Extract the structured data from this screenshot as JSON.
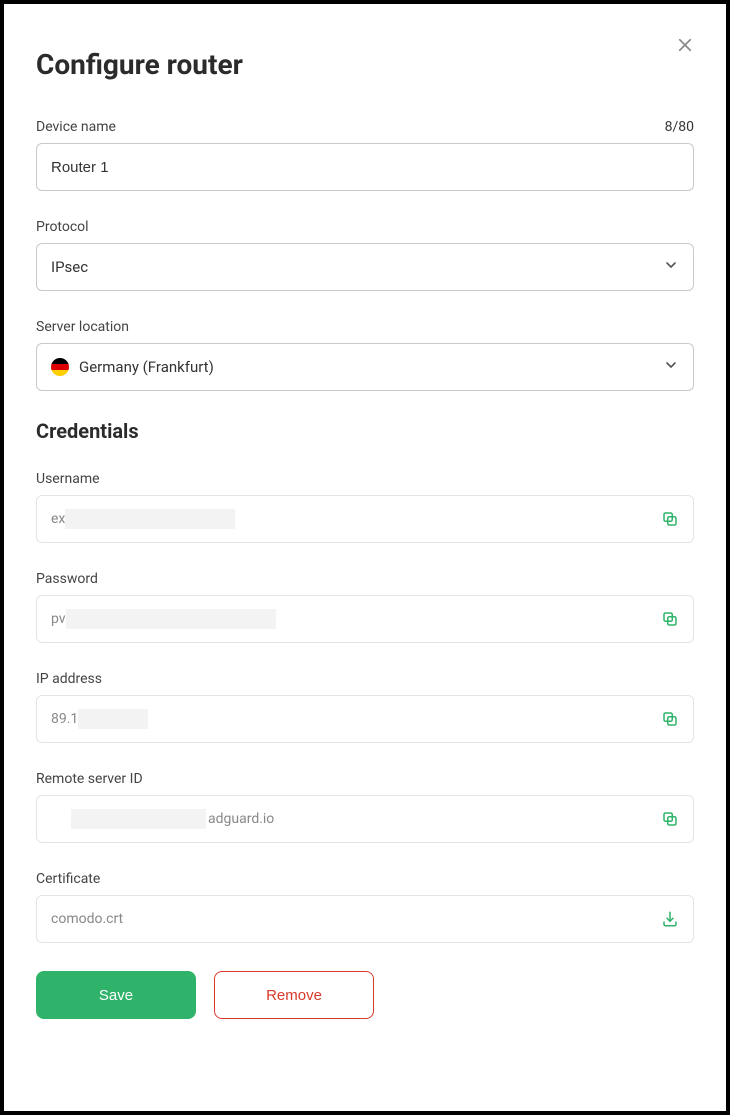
{
  "title": "Configure router",
  "deviceName": {
    "label": "Device name",
    "counter": "8/80",
    "value": "Router 1"
  },
  "protocol": {
    "label": "Protocol",
    "value": "IPsec"
  },
  "serverLocation": {
    "label": "Server location",
    "value": "Germany (Frankfurt)"
  },
  "credentialsTitle": "Credentials",
  "username": {
    "label": "Username",
    "prefix": "ex"
  },
  "password": {
    "label": "Password",
    "prefix": "pv"
  },
  "ip": {
    "label": "IP address",
    "prefix": "89.1"
  },
  "remoteServer": {
    "label": "Remote server ID",
    "suffix": "adguard.io"
  },
  "certificate": {
    "label": "Certificate",
    "value": "comodo.crt"
  },
  "actions": {
    "save": "Save",
    "remove": "Remove"
  }
}
